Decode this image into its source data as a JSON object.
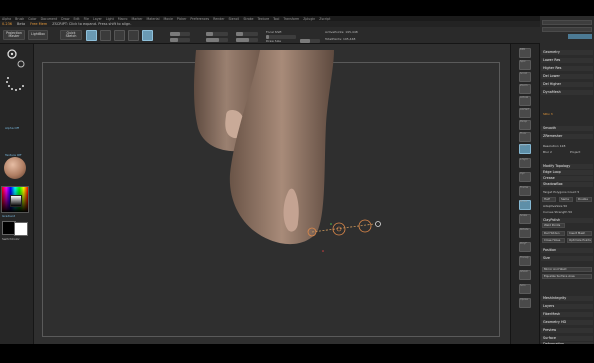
{
  "menu": [
    "Alpha",
    "Brush",
    "Color",
    "Document",
    "Draw",
    "Edit",
    "File",
    "Layer",
    "Light",
    "Macro",
    "Marker",
    "Material",
    "Movie",
    "Picker",
    "Preferences",
    "Render",
    "Stencil",
    "Stroke",
    "Texture",
    "Tool",
    "Transform",
    "Zplugin",
    "Zscript"
  ],
  "status": {
    "mem": "0.236",
    "version": "Beta",
    "message": "ZSCRIPT: Click to expand. Press shift to align.",
    "hint": "Free Mem"
  },
  "topbar": {
    "projection_master": "Projection Master",
    "lightbox": "LightBox",
    "quick_sketch": "Quick Sketch",
    "edit": "Edit",
    "draw": "Draw",
    "move": "Move",
    "scale": "Scale",
    "rotate": "Rotate",
    "focal_shift": "Focal Shift",
    "draw_size": "Draw Size",
    "active_points": "ActivePoints: 195,448",
    "total_points": "TotalPoints: 195,448"
  },
  "left": {
    "lightbox_label": "Alpha Off",
    "texture_label": "Texture Off",
    "material_label": "MatCap",
    "switch_label": "SwitchColor",
    "gradient_label": "Gradient"
  },
  "right_shelf": [
    "BPR",
    "Spix",
    "Scroll",
    "Zoom",
    "Actual",
    "AAHalf",
    "Persp",
    "Floor",
    "Local",
    "L.Sym",
    "Xyz",
    "Frame",
    "Move",
    "Scale",
    "Rotate",
    "PolyF",
    "Transp",
    "Ghost",
    "Solo",
    "Xpose"
  ],
  "tray": {
    "sections": [
      "Geometry",
      "Lower Res",
      "Higher Res",
      "Del Lower",
      "Del Higher",
      "DynaMesh",
      "Smooth",
      "ZRemesher",
      "Modify Topology",
      "Edge Loop",
      "Crease",
      "ShadowBox",
      "ClayPolish",
      "Position",
      "Size",
      "MeshIntegrity",
      "Layers",
      "FiberMesh",
      "Geometry HD",
      "Preview",
      "Surface",
      "Deformation"
    ],
    "subdiv": "SDiv 3",
    "resolution": "Resolution 128",
    "blur": "Blur 2",
    "project": "Project",
    "target_poly": "Target Polygons Count 5",
    "half": "Half",
    "same": "Same",
    "double": "Double",
    "adaptive": "AdaptiveSize 50",
    "curves": "Curves Strength 50",
    "weld_points": "Weld Points",
    "del_hidden": "Del Hidden",
    "insert_mesh": "Insert Mesh",
    "close_holes": "Close Holes",
    "optimize": "Optimize Points",
    "mirror_weld": "Mirror And Weld",
    "equalize": "Equalize Surface Area"
  },
  "colors": {
    "accent": "#e89a3a",
    "select": "#5e8fa8",
    "canvas": "#2f2f2f",
    "skin": "#8e7566"
  },
  "icons": [
    "sphere-icon",
    "stroke-dots-icon",
    "gear-icon",
    "brush-icon",
    "move-icon",
    "scale-icon",
    "rotate-icon",
    "color-picker-icon",
    "material-sphere-icon",
    "transpose-line-icon"
  ]
}
